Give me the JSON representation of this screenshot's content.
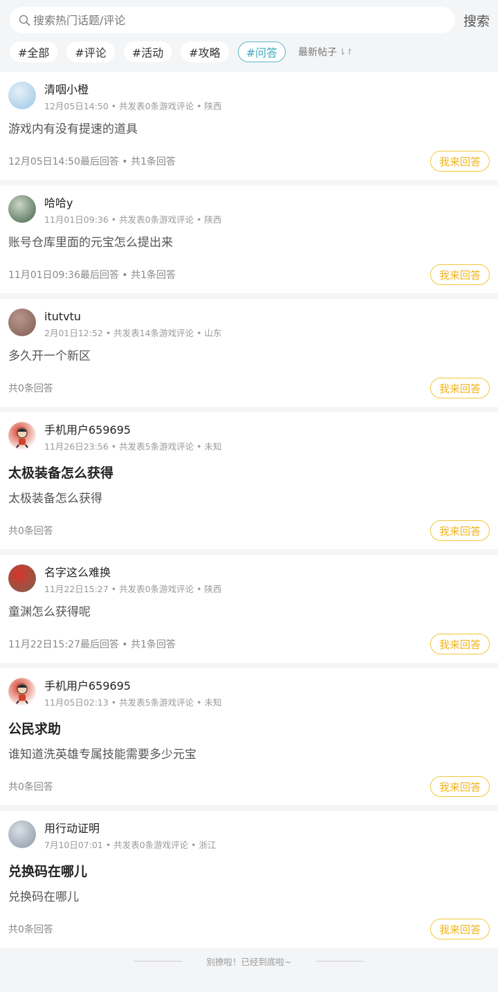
{
  "search": {
    "placeholder": "搜索热门话题/评论",
    "button_label": "搜索"
  },
  "tabs": [
    {
      "label": "#全部",
      "active": false
    },
    {
      "label": "#评论",
      "active": false
    },
    {
      "label": "#活动",
      "active": false
    },
    {
      "label": "#攻略",
      "active": false
    },
    {
      "label": "#问答",
      "active": true
    }
  ],
  "sort": {
    "label": "最新帖子",
    "icon": "sort-arrows-icon"
  },
  "answer_label": "我来回答",
  "posts": [
    {
      "author": "清咽小橙",
      "meta": "12月05日14:50 • 共发表0条游戏评论 • 陕西",
      "title": "",
      "body": "游戏内有没有提速的道具",
      "reply_info": "12月05日14:50最后回答 • 共1条回答",
      "avatar_color": "#a9cfe8",
      "avatar_accent": "#e6f1f8"
    },
    {
      "author": "哈哈y",
      "meta": "11月01日09:36 • 共发表0条游戏评论 • 陕西",
      "title": "",
      "body": "账号仓库里面的元宝怎么提出来",
      "reply_info": "11月01日09:36最后回答 • 共1条回答",
      "avatar_color": "#5f7a62",
      "avatar_accent": "#c9d6c5"
    },
    {
      "author": "itutvtu",
      "meta": "2月01日12:52 • 共发表14条游戏评论 • 山东",
      "title": "",
      "body": "多久开一个新区",
      "reply_info": "共0条回答",
      "avatar_color": "#8a6a5e",
      "avatar_accent": "#b8958a"
    },
    {
      "author": "手机用户659695",
      "meta": "11月26日23:56 • 共发表5条游戏评论 • 未知",
      "title": "太极装备怎么获得",
      "body": "太极装备怎么获得",
      "reply_info": "共0条回答",
      "avatar_color": "#ffffff",
      "avatar_accent": "#d3432b"
    },
    {
      "author": "名字这么难换",
      "meta": "11月22日15:27 • 共发表0条游戏评论 • 陕西",
      "title": "",
      "body": "童渊怎么获得呢",
      "reply_info": "11月22日15:27最后回答 • 共1条回答",
      "avatar_color": "#8c5a4a",
      "avatar_accent": "#d6352a"
    },
    {
      "author": "手机用户659695",
      "meta": "11月05日02:13 • 共发表5条游戏评论 • 未知",
      "title": "公民求助",
      "body": "谁知道洗英雄专属技能需要多少元宝",
      "reply_info": "共0条回答",
      "avatar_color": "#ffffff",
      "avatar_accent": "#d3432b"
    },
    {
      "author": "用行动证明",
      "meta": "7月10日07:01 • 共发表0条游戏评论 • 浙江",
      "title": "兑换码在哪儿",
      "body": "兑换码在哪儿",
      "reply_info": "共0条回答",
      "avatar_color": "#9aa6b2",
      "avatar_accent": "#d9dfe6"
    }
  ],
  "end_text": "别撩啦！已经到底啦~"
}
